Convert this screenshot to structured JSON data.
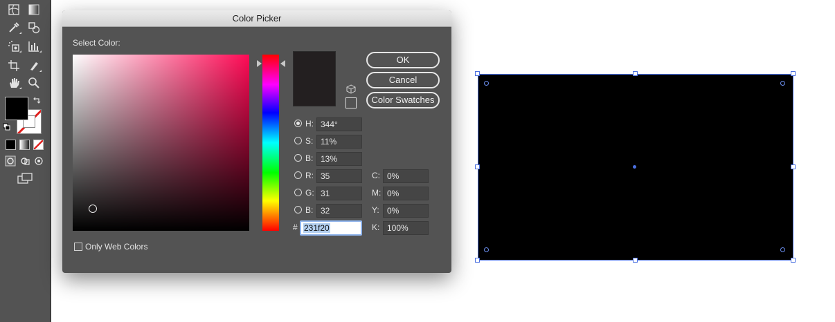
{
  "dialog": {
    "title": "Color Picker",
    "select_label": "Select Color:",
    "buttons": {
      "ok": "OK",
      "cancel": "Cancel",
      "swatches": "Color Swatches"
    },
    "hsb": {
      "h": {
        "label": "H:",
        "value": "344°"
      },
      "s": {
        "label": "S:",
        "value": "11%"
      },
      "b": {
        "label": "B:",
        "value": "13%"
      }
    },
    "rgb": {
      "r": {
        "label": "R:",
        "value": "35"
      },
      "g": {
        "label": "G:",
        "value": "31"
      },
      "b": {
        "label": "B:",
        "value": "32"
      }
    },
    "cmyk": {
      "c": {
        "label": "C:",
        "value": "0%"
      },
      "m": {
        "label": "M:",
        "value": "0%"
      },
      "y": {
        "label": "Y:",
        "value": "0%"
      },
      "k": {
        "label": "K:",
        "value": "100%"
      }
    },
    "hex": {
      "label": "#",
      "value": "231f20"
    },
    "web_colors_label": "Only Web Colors",
    "selected_color": "#231f20",
    "selected_mode": "H"
  },
  "toolbar": {
    "fill_color": "#000000",
    "stroke": "none"
  },
  "artboard": {
    "rect_fill": "#000000",
    "selection_color": "#4a6fe0"
  }
}
